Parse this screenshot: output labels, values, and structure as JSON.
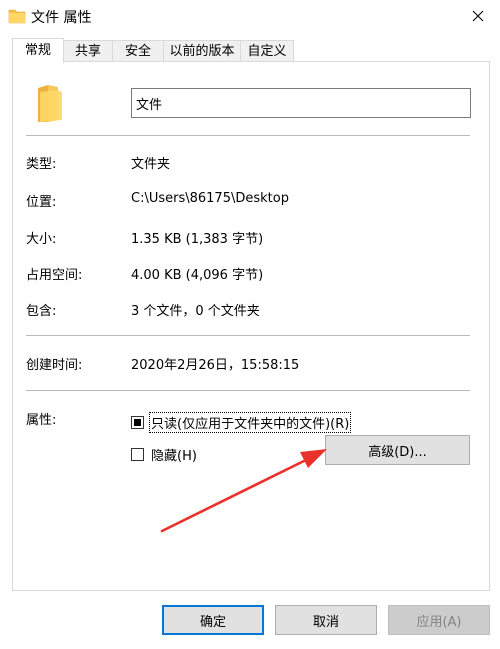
{
  "window": {
    "title": "文件 属性"
  },
  "tabs": [
    {
      "label": "常规"
    },
    {
      "label": "共享"
    },
    {
      "label": "安全"
    },
    {
      "label": "以前的版本"
    },
    {
      "label": "自定义"
    }
  ],
  "general": {
    "name_value": "文件",
    "type_label": "类型:",
    "type_value": "文件夹",
    "location_label": "位置:",
    "location_value": "C:\\Users\\86175\\Desktop",
    "size_label": "大小:",
    "size_value": "1.35 KB (1,383 字节)",
    "disk_label": "占用空间:",
    "disk_value": "4.00 KB (4,096 字节)",
    "contains_label": "包含:",
    "contains_value": "3 个文件，0 个文件夹",
    "created_label": "创建时间:",
    "created_value": "2020年2月26日，15:58:15",
    "attributes_label": "属性:",
    "readonly_label": "只读(仅应用于文件夹中的文件)(R)",
    "readonly_state": "indeterminate",
    "hidden_label": "隐藏(H)",
    "hidden_state": "unchecked",
    "advanced_button": "高级(D)..."
  },
  "buttons": {
    "ok": "确定",
    "cancel": "取消",
    "apply": "应用(A)"
  },
  "colors": {
    "accent": "#0078d7",
    "folder": "#f4c44e",
    "arrow": "#e8322a"
  }
}
